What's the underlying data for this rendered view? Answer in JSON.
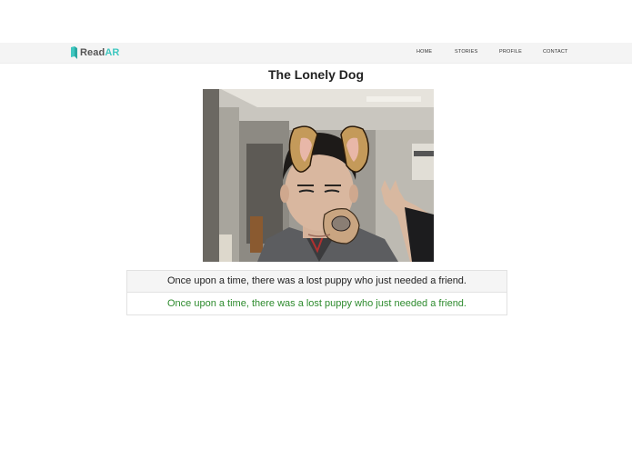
{
  "header": {
    "logo_text_main": "Read",
    "logo_text_accent": "AR",
    "nav": [
      "HOME",
      "STORIES",
      "PROFILE",
      "CONTACT"
    ],
    "accent_color": "#3fc7c0"
  },
  "story": {
    "title": "The Lonely Dog",
    "image_icon": "camera-feed-with-dog-filter",
    "original_line": "Once upon a time, there was a lost puppy who just needed a friend.",
    "spoken_line": "Once upon a time, there was a lost puppy who just needed a friend.",
    "spoken_color": "#2e8b2e"
  }
}
